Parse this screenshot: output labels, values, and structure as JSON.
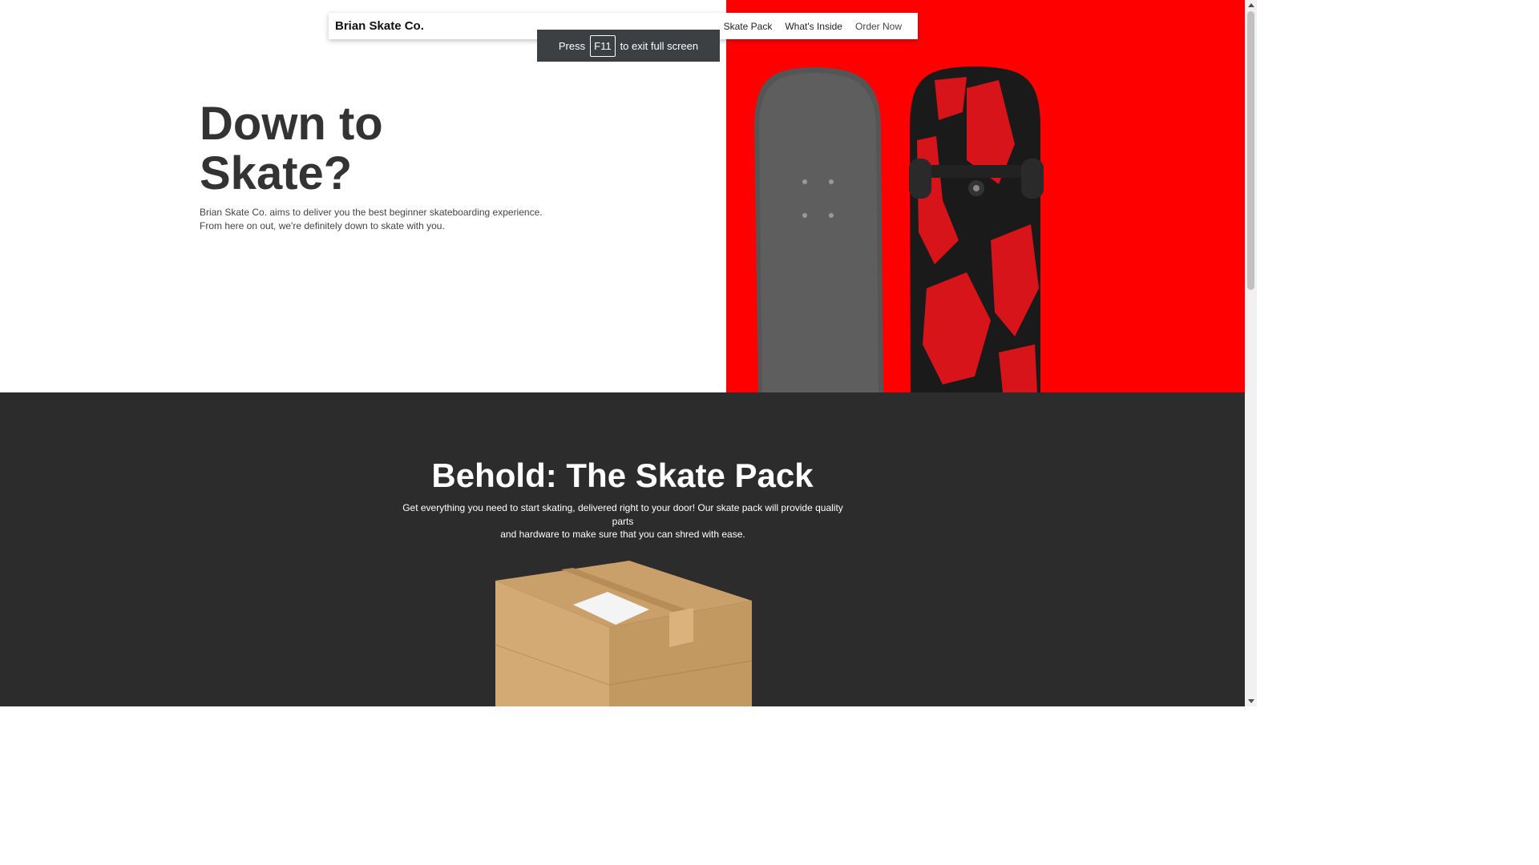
{
  "navbar": {
    "brand": "Brian Skate Co.",
    "links": [
      "Skate Pack",
      "What's Inside",
      "Order Now"
    ]
  },
  "fullscreen_toast": {
    "prefix": "Press",
    "key": "F11",
    "suffix": "to exit full screen"
  },
  "hero": {
    "title_line1": "Down to",
    "title_line2": "Skate?",
    "desc_line1": "Brian Skate Co. aims to deliver you the best beginner skateboarding experience.",
    "desc_line2": "From here on out, we're definitely down to skate with you.",
    "accent_color": "#fe0000"
  },
  "skate_pack": {
    "title": "Behold: The Skate Pack",
    "desc_line1": "Get everything you need to start skating, delivered right to your door! Our skate pack will provide quality parts",
    "desc_line2": "and hardware to make sure that you can shred with ease.",
    "background": "#2c2c2c"
  }
}
